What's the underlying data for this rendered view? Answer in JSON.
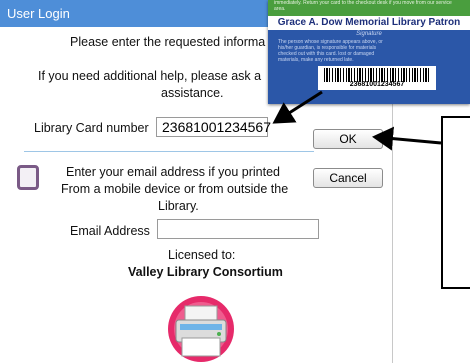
{
  "dialog": {
    "title": "User Login",
    "line1": "Please enter the requested informa",
    "help_line1": "If you need additional help, please ask a",
    "help_line2": "assistance.",
    "card_label": "Library Card number",
    "card_value": "23681001234567",
    "ok_label": "OK",
    "email_line1": "Enter your email address if you printed",
    "email_line2": "From a mobile device or from outside the",
    "email_line3": "Library.",
    "email_label": "Email Address",
    "email_value": "",
    "cancel_label": "Cancel",
    "licensed_label": "Licensed to:",
    "licensee": "Valley Library Consortium"
  },
  "card": {
    "fine_print": "immediately. Return your card to the checkout desk if you move from our service area.",
    "title": "Grace A. Dow Memorial Library Patron",
    "signature_label": "Signature",
    "body_text": "The person whose signature appears above, or his/her guardian, is responsible for materials checked out with this card. lost or damaged materials, make any returned late.",
    "barcode_number": "23681001234567"
  },
  "colors": {
    "titlebar": "#4e8ed8",
    "card_blue": "#2b57a8",
    "card_green": "#4a9e3e"
  }
}
